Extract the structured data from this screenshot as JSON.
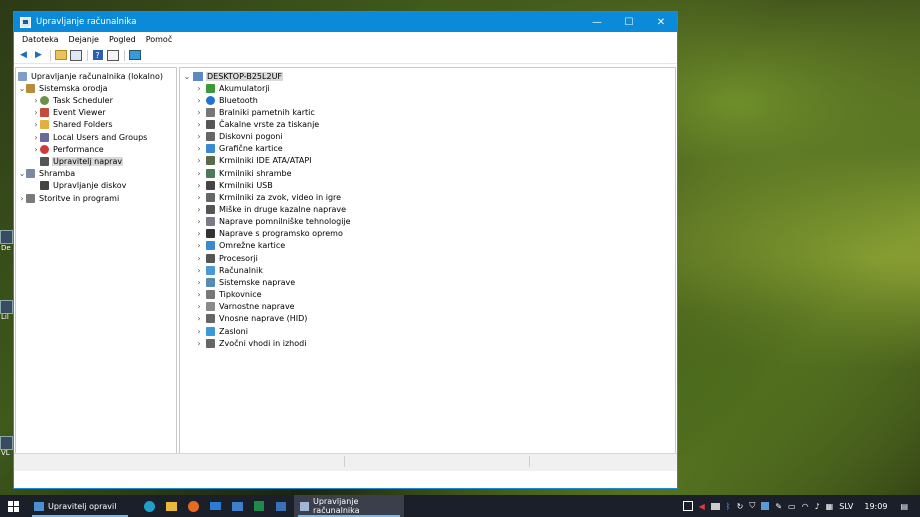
{
  "window": {
    "title": "Upravljanje računalnika",
    "minimize": "—",
    "maximize": "☐",
    "close": "✕"
  },
  "menu": [
    "Datoteka",
    "Dejanje",
    "Pogled",
    "Pomoč"
  ],
  "toolbar_icons": [
    "back-arrow-icon",
    "forward-arrow-icon",
    "up-folder-icon",
    "show-hide-tree-icon",
    "help-icon",
    "properties-icon",
    "monitor-icon"
  ],
  "left_tree": [
    {
      "label": "Upravljanje računalnika (lokalno)",
      "level": 0,
      "expander": "",
      "icon": "computer-management-icon"
    },
    {
      "label": "Sistemska orodja",
      "level": 1,
      "expander": "⌄",
      "icon": "tools-icon"
    },
    {
      "label": "Task Scheduler",
      "level": 2,
      "expander": "›",
      "icon": "clock-icon"
    },
    {
      "label": "Event Viewer",
      "level": 2,
      "expander": "›",
      "icon": "event-viewer-icon"
    },
    {
      "label": "Shared Folders",
      "level": 2,
      "expander": "›",
      "icon": "shared-folder-icon"
    },
    {
      "label": "Local Users and Groups",
      "level": 2,
      "expander": "›",
      "icon": "users-icon"
    },
    {
      "label": "Performance",
      "level": 2,
      "expander": "›",
      "icon": "performance-icon"
    },
    {
      "label": "Upravitelj naprav",
      "level": 2,
      "expander": "",
      "icon": "device-manager-icon",
      "selected": true
    },
    {
      "label": "Shramba",
      "level": 1,
      "expander": "⌄",
      "icon": "storage-icon"
    },
    {
      "label": "Upravljanje diskov",
      "level": 2,
      "expander": "",
      "icon": "disk-management-icon"
    },
    {
      "label": "Storitve in programi",
      "level": 1,
      "expander": "›",
      "icon": "services-icon"
    }
  ],
  "device_root": "DESKTOP-B25L2UF",
  "devices": [
    {
      "label": "Akumulatorji",
      "icon": "battery-icon"
    },
    {
      "label": "Bluetooth",
      "icon": "bluetooth-icon"
    },
    {
      "label": "Bralniki pametnih kartic",
      "icon": "smart-card-icon"
    },
    {
      "label": "Čakalne vrste za tiskanje",
      "icon": "printer-icon"
    },
    {
      "label": "Diskovni pogoni",
      "icon": "disk-drive-icon"
    },
    {
      "label": "Grafične kartice",
      "icon": "display-adapter-icon"
    },
    {
      "label": "Krmilniki IDE ATA/ATAPI",
      "icon": "ide-controller-icon"
    },
    {
      "label": "Krmilniki shrambe",
      "icon": "storage-controller-icon"
    },
    {
      "label": "Krmilniki USB",
      "icon": "usb-icon"
    },
    {
      "label": "Krmilniki za zvok, video in igre",
      "icon": "sound-icon"
    },
    {
      "label": "Miške in druge kazalne naprave",
      "icon": "mouse-icon"
    },
    {
      "label": "Naprave pomnilniške tehnologije",
      "icon": "memory-icon"
    },
    {
      "label": "Naprave s programsko opremo",
      "icon": "software-device-icon"
    },
    {
      "label": "Omrežne kartice",
      "icon": "network-adapter-icon"
    },
    {
      "label": "Procesorji",
      "icon": "processor-icon"
    },
    {
      "label": "Računalnik",
      "icon": "computer-icon"
    },
    {
      "label": "Sistemske naprave",
      "icon": "system-device-icon"
    },
    {
      "label": "Tipkovnice",
      "icon": "keyboard-icon"
    },
    {
      "label": "Varnostne naprave",
      "icon": "security-device-icon"
    },
    {
      "label": "Vnosne naprave (HID)",
      "icon": "hid-icon"
    },
    {
      "label": "Zasloni",
      "icon": "monitor-icon"
    },
    {
      "label": "Zvočni vhodi in izhodi",
      "icon": "audio-io-icon"
    }
  ],
  "desktop_labels": [
    "De",
    "Lil",
    "VL"
  ],
  "taskbar": {
    "pinned": [
      "start-icon",
      "edge-icon",
      "file-explorer-icon",
      "firefox-icon",
      "mail-icon",
      "photos-icon",
      "excel-icon",
      "cmd-icon"
    ],
    "task_manager_label": "Upravitelj opravil",
    "computer_mgmt_label": "Upravljanje računalnika",
    "language": "SLV",
    "time": "19:09"
  },
  "colors": {
    "titlebar": "#0a8ad8",
    "taskbar": "#1b1f2a",
    "selection": "#d9d9d9"
  }
}
